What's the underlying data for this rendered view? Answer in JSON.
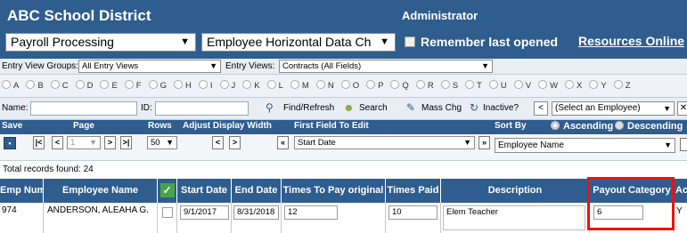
{
  "header": {
    "org": "ABC School District",
    "role": "Administrator",
    "module_select": "Payroll Processing",
    "form_select": "Employee Horizontal Data Ch",
    "remember_label": "Remember last opened",
    "resources_link": "Resources Online"
  },
  "views": {
    "groups_label": "Entry View Groups:",
    "groups_value": "All Entry Views",
    "views_label": "Entry Views:",
    "views_value": "Contracts (All Fields)"
  },
  "alphabet": [
    "A",
    "B",
    "C",
    "D",
    "E",
    "F",
    "G",
    "H",
    "I",
    "J",
    "K",
    "L",
    "M",
    "N",
    "O",
    "P",
    "Q",
    "R",
    "S",
    "T",
    "U",
    "V",
    "W",
    "X",
    "Y",
    "Z"
  ],
  "search": {
    "name_label": "Name:",
    "id_label": "ID:",
    "find_refresh": "Find/Refresh",
    "search": "Search",
    "mass_chg": "Mass Chg",
    "inactive": "Inactive?",
    "employee_select": "(Select an Employee)"
  },
  "nav_headers": {
    "save": "Save",
    "page": "Page",
    "rows": "Rows",
    "adjust": "Adjust Display Width",
    "first_field": "First Field To Edit",
    "sort_by": "Sort By",
    "ascending": "Ascending",
    "descending": "Descending"
  },
  "controls": {
    "page_value": "1",
    "rows_value": "50",
    "first_field_value": "Start Date",
    "sort_value": "Employee Name"
  },
  "total_records": "Total records found: 24",
  "grid": {
    "columns": [
      "Emp Num",
      "Employee Name",
      "",
      "Start Date",
      "End Date",
      "Times To Pay original",
      "Times Paid",
      "Description",
      "Payout Category",
      "Ac"
    ],
    "row": {
      "emp_num": "974",
      "employee_name": "ANDERSON, ALEAHA G.",
      "start_date": "9/1/2017",
      "end_date": "8/31/2018",
      "times_to_pay": "12",
      "times_paid": "10",
      "description": "Elem Teacher",
      "payout_category": "6",
      "ac": "Y"
    }
  },
  "colors": {
    "navy": "#2f5d8e",
    "highlight": "#e11111"
  }
}
